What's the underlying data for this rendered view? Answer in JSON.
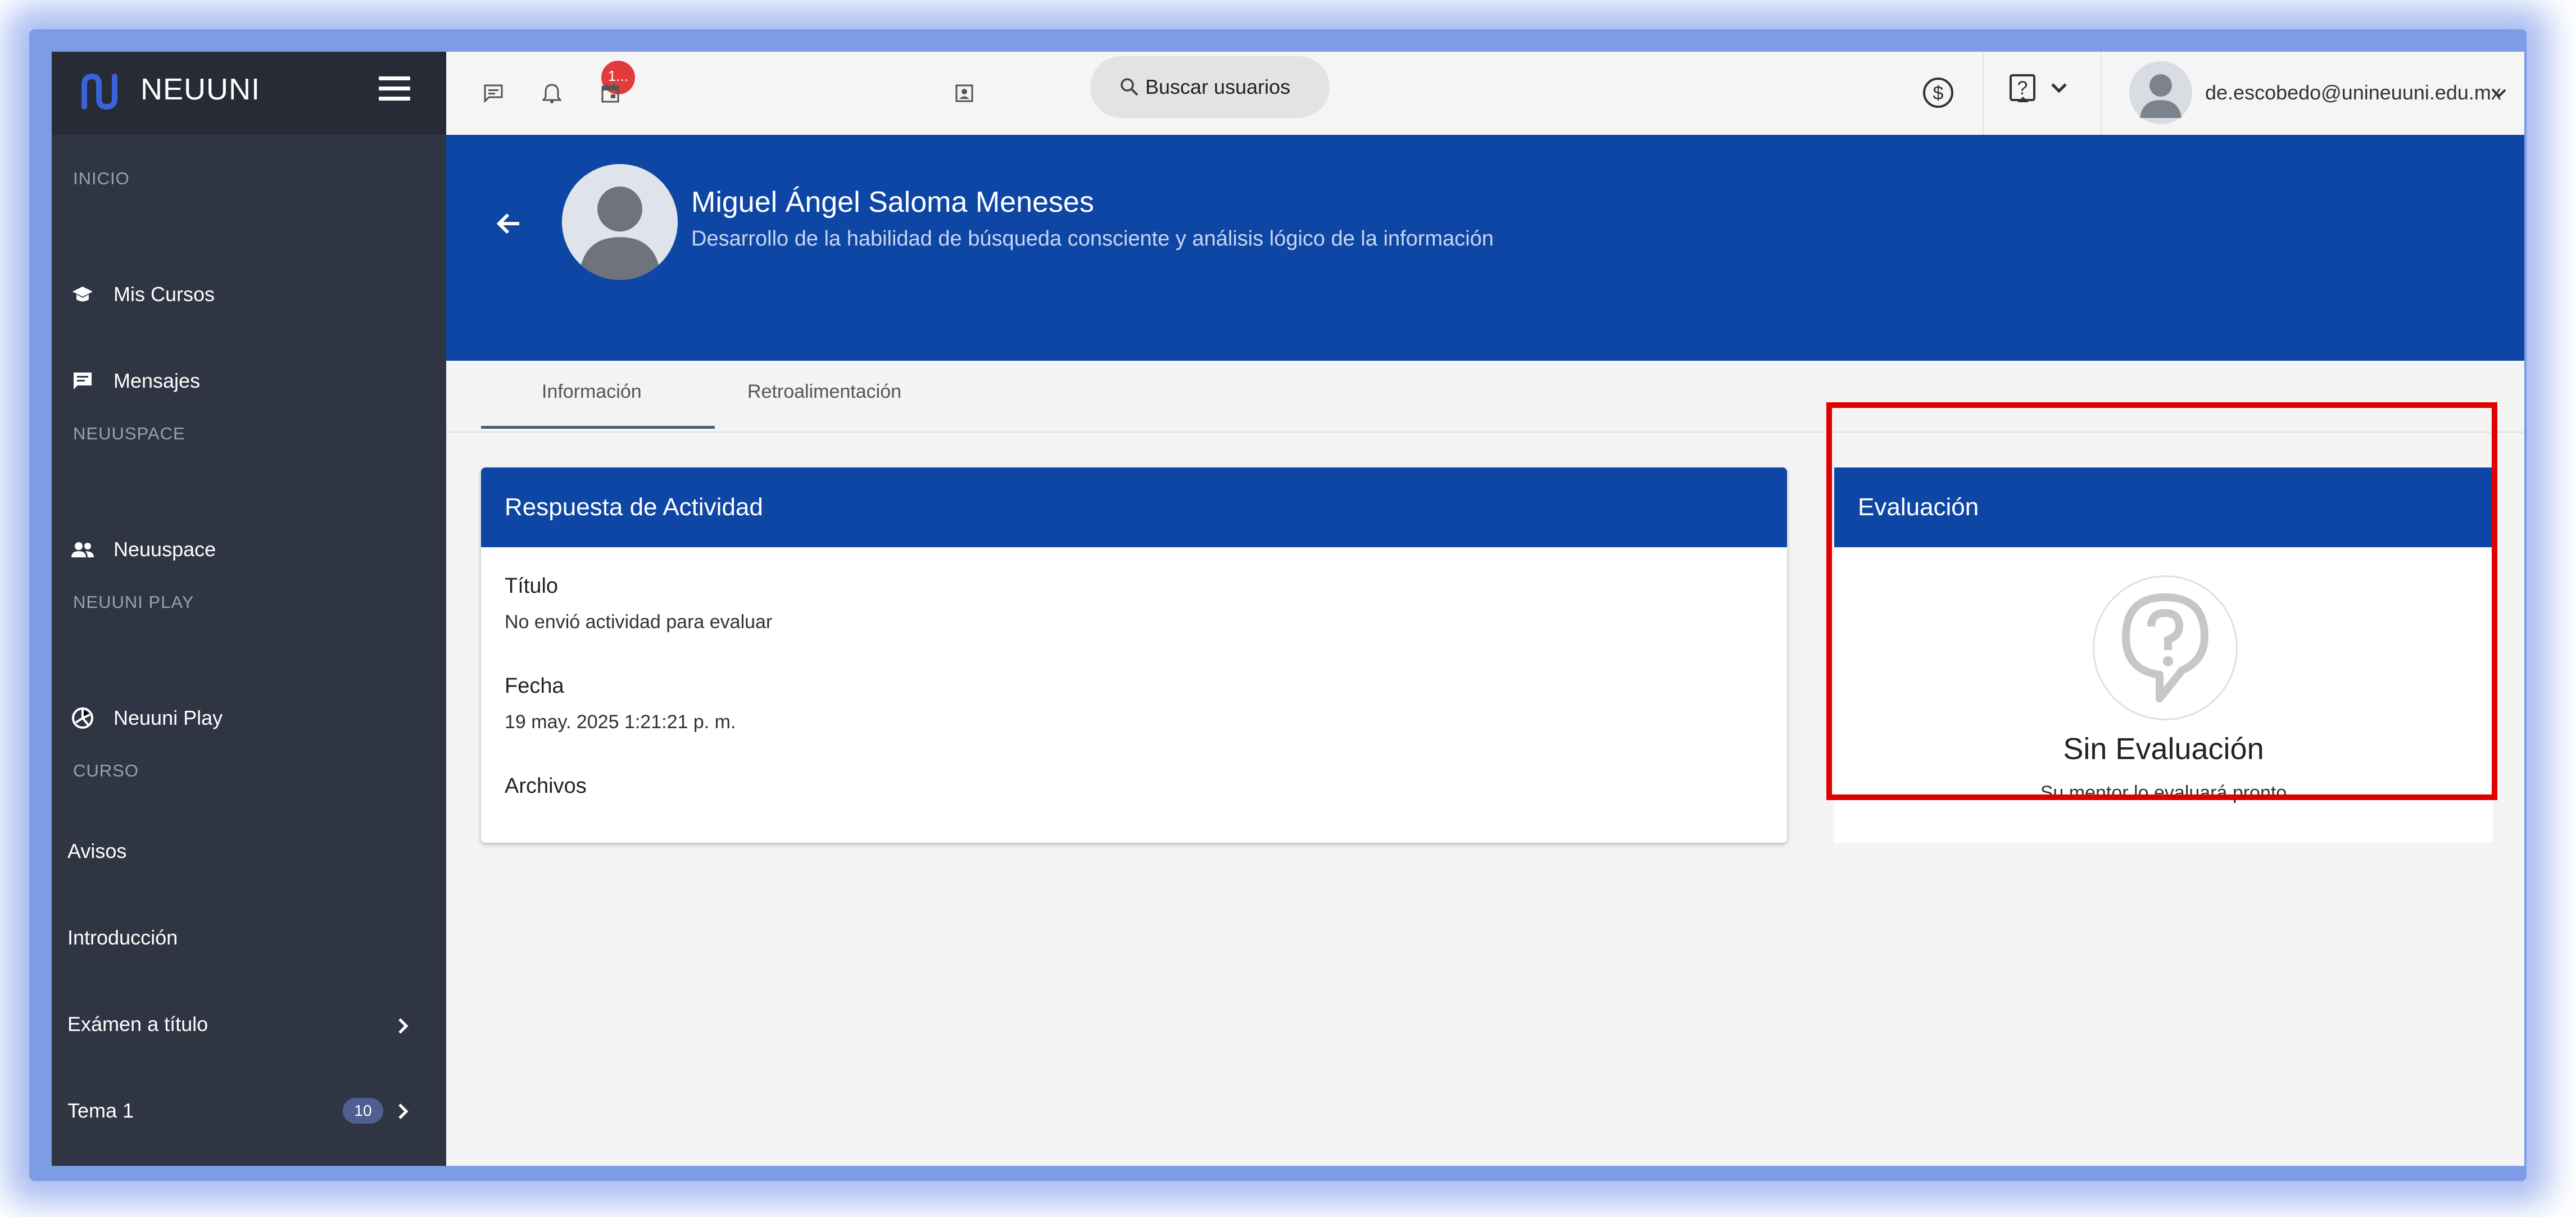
{
  "brand": {
    "name": "NEUUNI"
  },
  "sidebar": {
    "sections": {
      "inicio": "INICIO",
      "neuuspace": "NEUUSPACE",
      "neuuni_play": "NEUUNI PLAY",
      "curso": "CURSO"
    },
    "items": {
      "mis_cursos": "Mis Cursos",
      "mensajes": "Mensajes",
      "neuuspace": "Neuuspace",
      "neuuni_play": "Neuuni Play",
      "avisos": "Avisos",
      "introduccion": "Introducción",
      "examen": "Exámen a título",
      "tema1": "Tema 1",
      "tema1_badge": "10"
    }
  },
  "topbar": {
    "notif_count": "1...",
    "search_label": "Buscar usuarios",
    "user_email": "de.escobedo@unineuuni.edu.mx"
  },
  "header": {
    "student_name": "Miguel Ángel Saloma Meneses",
    "course_title": "Desarrollo de la habilidad de búsqueda consciente y análisis lógico de la información"
  },
  "tabs": {
    "info": "Información",
    "feedback": "Retroalimentación"
  },
  "respuesta": {
    "title": "Respuesta de Actividad",
    "titulo_label": "Título",
    "titulo_value": "No envió actividad para evaluar",
    "fecha_label": "Fecha",
    "fecha_value": "19 may. 2025 1:21:21 p. m.",
    "archivos_label": "Archivos"
  },
  "evaluacion": {
    "title": "Evaluación",
    "status": "Sin Evaluación",
    "subtitle": "Su mentor lo evaluará pronto"
  },
  "colors": {
    "primary": "#0e46a5",
    "sidebar": "#2f3542",
    "highlight": "#e00000"
  }
}
